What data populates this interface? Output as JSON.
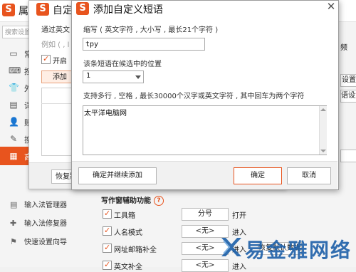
{
  "background_window": {
    "title": "属",
    "search_placeholder": "搜索设置",
    "sidebar": [
      {
        "icon": "monitor-icon",
        "glyph": "▭",
        "label": "常"
      },
      {
        "icon": "keyboard-icon",
        "glyph": "⌨",
        "label": "按"
      },
      {
        "icon": "shirt-icon",
        "glyph": "👕",
        "label": "外"
      },
      {
        "icon": "book-icon",
        "glyph": "▤",
        "label": "词"
      },
      {
        "icon": "user-icon",
        "glyph": "👤",
        "label": "账"
      },
      {
        "icon": "magic-icon",
        "glyph": "✎",
        "label": "搜"
      },
      {
        "icon": "advanced-icon",
        "glyph": "▦",
        "label": "高",
        "active": true
      }
    ],
    "bottom_links": [
      {
        "icon": "manager-icon",
        "glyph": "▤",
        "label": "输入法管理器"
      },
      {
        "icon": "repair-icon",
        "glyph": "✚",
        "label": "输入法修复器"
      },
      {
        "icon": "flag-icon",
        "glyph": "⚑",
        "label": "快速设置向导"
      }
    ],
    "assist": {
      "heading": "写作窗辅助功能",
      "help_glyph": "?",
      "rows": [
        {
          "label": "工具箱",
          "checked": true,
          "key": "分号",
          "action": "打开"
        },
        {
          "label": "人名模式",
          "checked": true,
          "key": "<无>",
          "action": "进入"
        },
        {
          "label": "网址邮箱补全",
          "checked": true,
          "key": "<无>",
          "action": "进入"
        },
        {
          "label": "英文补全",
          "checked": true,
          "key": "<无>",
          "action": "进入"
        }
      ],
      "restore_defaults_label": "恢复默认数据"
    },
    "right_clipped": {
      "frequency": "频",
      "settings": "设置",
      "phrase": "语设置"
    }
  },
  "middle_dialog": {
    "title": "自定",
    "description": "通过英文",
    "example": "例如 ( , l",
    "enable_label": "开启",
    "add_button": "添加",
    "restore_button": "恢复默"
  },
  "dialog": {
    "title": "添加自定义短语",
    "close_glyph": "✕",
    "abbr_label": "缩写 ( 英文字符 , 大小写 , 最长21个字符 )",
    "abbr_value": "tpy",
    "position_label": "该条短语在候选中的位置",
    "position_value": "1",
    "multi_label": "支持多行 , 空格 , 最长30000个汉字或英文字符 , 其中回车为两个字符",
    "phrase_text": "太平洋电脑网",
    "buttons": {
      "continue": "确定并继续添加",
      "ok": "确定",
      "cancel": "取消"
    }
  },
  "watermark": {
    "text": "易金雅网络"
  },
  "colors": {
    "accent": "#e8541e",
    "watermark": "#1c5fa8"
  }
}
